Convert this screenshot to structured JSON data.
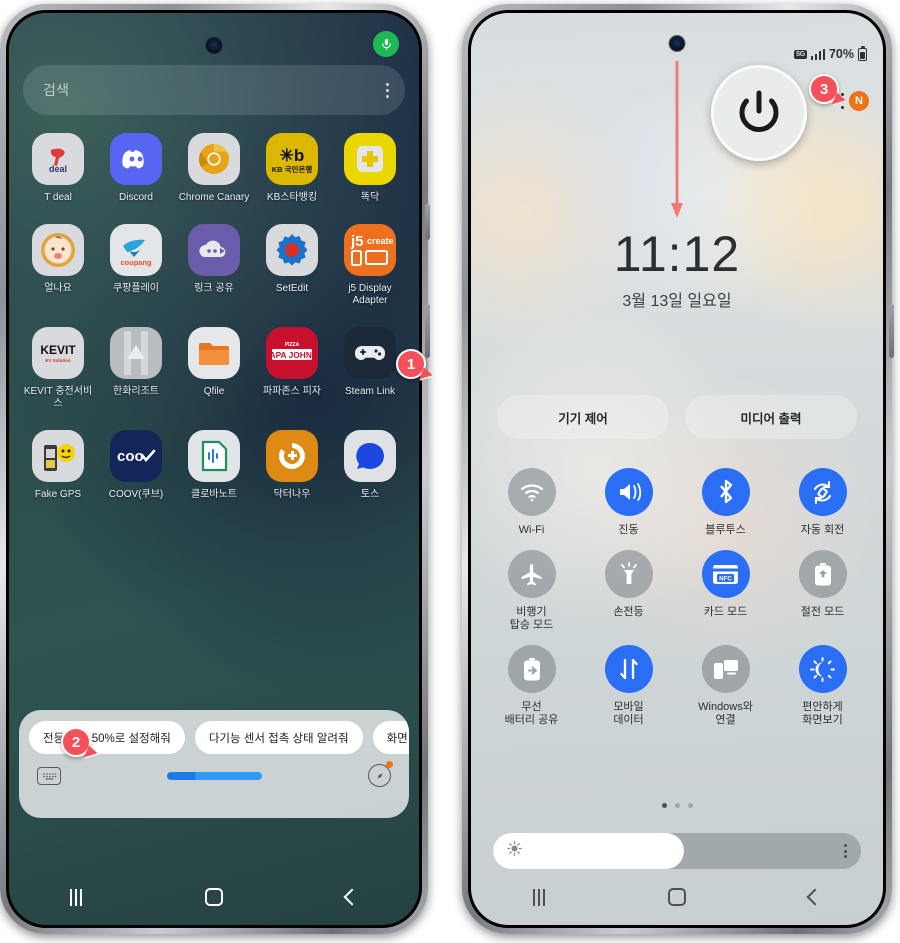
{
  "phone_left": {
    "name": "home-screen-phone",
    "search": {
      "placeholder": "검색",
      "menu_icon": "kebab-menu-icon",
      "mic_icon": "microphone-icon"
    },
    "apps": [
      [
        {
          "label": "T deal",
          "icon": "t-deal-icon"
        },
        {
          "label": "Discord",
          "icon": "discord-icon"
        },
        {
          "label": "Chrome Canary",
          "icon": "chrome-canary-icon"
        },
        {
          "label": "KB스타뱅킹",
          "icon": "kb-star-banking-icon"
        },
        {
          "label": "똑닥",
          "icon": "ddocdoc-icon"
        }
      ],
      [
        {
          "label": "얼나요",
          "icon": "eolnayo-icon"
        },
        {
          "label": "쿠팡플레이",
          "icon": "coupang-play-icon"
        },
        {
          "label": "링크 공유",
          "icon": "link-sharing-icon"
        },
        {
          "label": "SetEdit",
          "icon": "setedit-icon"
        },
        {
          "label": "j5 Display Adapter",
          "icon": "j5create-icon"
        }
      ],
      [
        {
          "label": "KEVIT 충전서비스",
          "icon": "kevit-icon"
        },
        {
          "label": "한화리조트",
          "icon": "hanwha-resort-icon"
        },
        {
          "label": "Qfile",
          "icon": "qfile-icon"
        },
        {
          "label": "파파존스 피자",
          "icon": "papa-johns-icon"
        },
        {
          "label": "Steam Link",
          "icon": "steam-link-icon"
        }
      ],
      [
        {
          "label": "Fake GPS",
          "icon": "fake-gps-icon"
        },
        {
          "label": "COOV(쿠브)",
          "icon": "coov-icon"
        },
        {
          "label": "클로바노트",
          "icon": "clova-note-icon"
        },
        {
          "label": "닥터나우",
          "icon": "doctor-now-icon"
        },
        {
          "label": "토스",
          "icon": "toss-icon"
        }
      ]
    ],
    "bixby": {
      "chips": [
        "전등 밝기 50%로 설정해줘",
        "다기능 센서 접촉 상태 알려줘",
        "화면 더 밝게 하"
      ],
      "keyboard_icon": "keyboard-icon",
      "compass_icon": "compass-icon",
      "voice_bar_level": "50"
    },
    "navbar": {
      "recent": "recent-apps-icon",
      "home": "home-icon",
      "back": "back-icon"
    }
  },
  "phone_right": {
    "name": "quick-panel-phone",
    "statusbar": {
      "network_badge": "5G",
      "signal_icon": "signal-bars-icon",
      "battery_percent": "70%",
      "battery_icon": "battery-icon"
    },
    "clock": {
      "time": "11:12",
      "date": "3월 13일 일요일"
    },
    "controls": [
      {
        "label": "기기 제어"
      },
      {
        "label": "미디어 출력"
      }
    ],
    "quick_settings": [
      [
        {
          "label": "Wi-Fi",
          "icon": "wifi-icon",
          "state": "off"
        },
        {
          "label": "진동",
          "icon": "vibrate-icon",
          "state": "on"
        },
        {
          "label": "블루투스",
          "icon": "bluetooth-icon",
          "state": "on"
        },
        {
          "label": "자동 회전",
          "icon": "auto-rotate-icon",
          "state": "on"
        }
      ],
      [
        {
          "label": "비행기\n탑승 모드",
          "icon": "airplane-icon",
          "state": "off"
        },
        {
          "label": "손전등",
          "icon": "flashlight-icon",
          "state": "off"
        },
        {
          "label": "카드 모드",
          "icon": "nfc-card-icon",
          "state": "on"
        },
        {
          "label": "절전 모드",
          "icon": "power-saving-icon",
          "state": "off"
        }
      ],
      [
        {
          "label": "무선\n배터리 공유",
          "icon": "wireless-battery-share-icon",
          "state": "off"
        },
        {
          "label": "모바일\n데이터",
          "icon": "mobile-data-icon",
          "state": "on"
        },
        {
          "label": "Windows와\n연결",
          "icon": "link-to-windows-icon",
          "state": "off"
        },
        {
          "label": "편안하게\n화면보기",
          "icon": "eye-comfort-shield-icon",
          "state": "on"
        }
      ]
    ],
    "page_dots": {
      "total": 3,
      "active": 1
    },
    "brightness": {
      "level": "52",
      "sun_icon": "brightness-sun-icon",
      "menu_icon": "kebab-menu-icon"
    },
    "status_badge_n": "N",
    "power_overlay_icon": "power-button-icon",
    "swipe_hint_icon": "swipe-down-arrow-icon",
    "navbar": {
      "recent": "recent-apps-icon",
      "home": "home-icon",
      "back": "back-icon"
    }
  },
  "callouts": [
    {
      "number": "1",
      "target": "side-key-button"
    },
    {
      "number": "2",
      "target": "bixby-suggestion-panel"
    },
    {
      "number": "3",
      "target": "power-button-overlay"
    }
  ],
  "colors": {
    "callout_red": "#f4505a",
    "toggle_on_blue": "#2a6ef5",
    "toggle_off_gray": "#78808655",
    "badge_orange": "#f07217",
    "mic_green": "#1db954"
  }
}
